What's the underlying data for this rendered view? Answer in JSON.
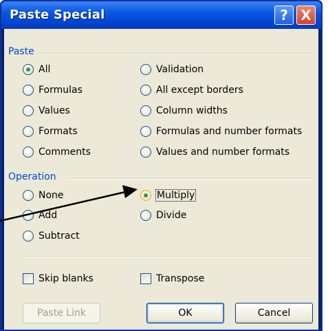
{
  "window": {
    "title": "Paste Special",
    "help_label": "?",
    "close_label": "X"
  },
  "paste_group": {
    "label": "Paste",
    "col1": [
      "All",
      "Formulas",
      "Values",
      "Formats",
      "Comments"
    ],
    "col2": [
      "Validation",
      "All except borders",
      "Column widths",
      "Formulas and number formats",
      "Values and number formats"
    ],
    "selected": "All"
  },
  "operation_group": {
    "label": "Operation",
    "col1": [
      "None",
      "Add",
      "Subtract"
    ],
    "col2": [
      "Multiply",
      "Divide"
    ],
    "selected": "Multiply"
  },
  "checkboxes": {
    "skip_blanks": "Skip blanks",
    "skip_blanks_checked": false,
    "transpose": "Transpose",
    "transpose_checked": false
  },
  "buttons": {
    "paste_link": "Paste Link",
    "ok": "OK",
    "cancel": "Cancel"
  },
  "colors": {
    "title_bar": "#0a57e0",
    "group_title": "#0046d5",
    "dialog_bg": "#ece9d8",
    "radio_selected": "#26a232"
  }
}
